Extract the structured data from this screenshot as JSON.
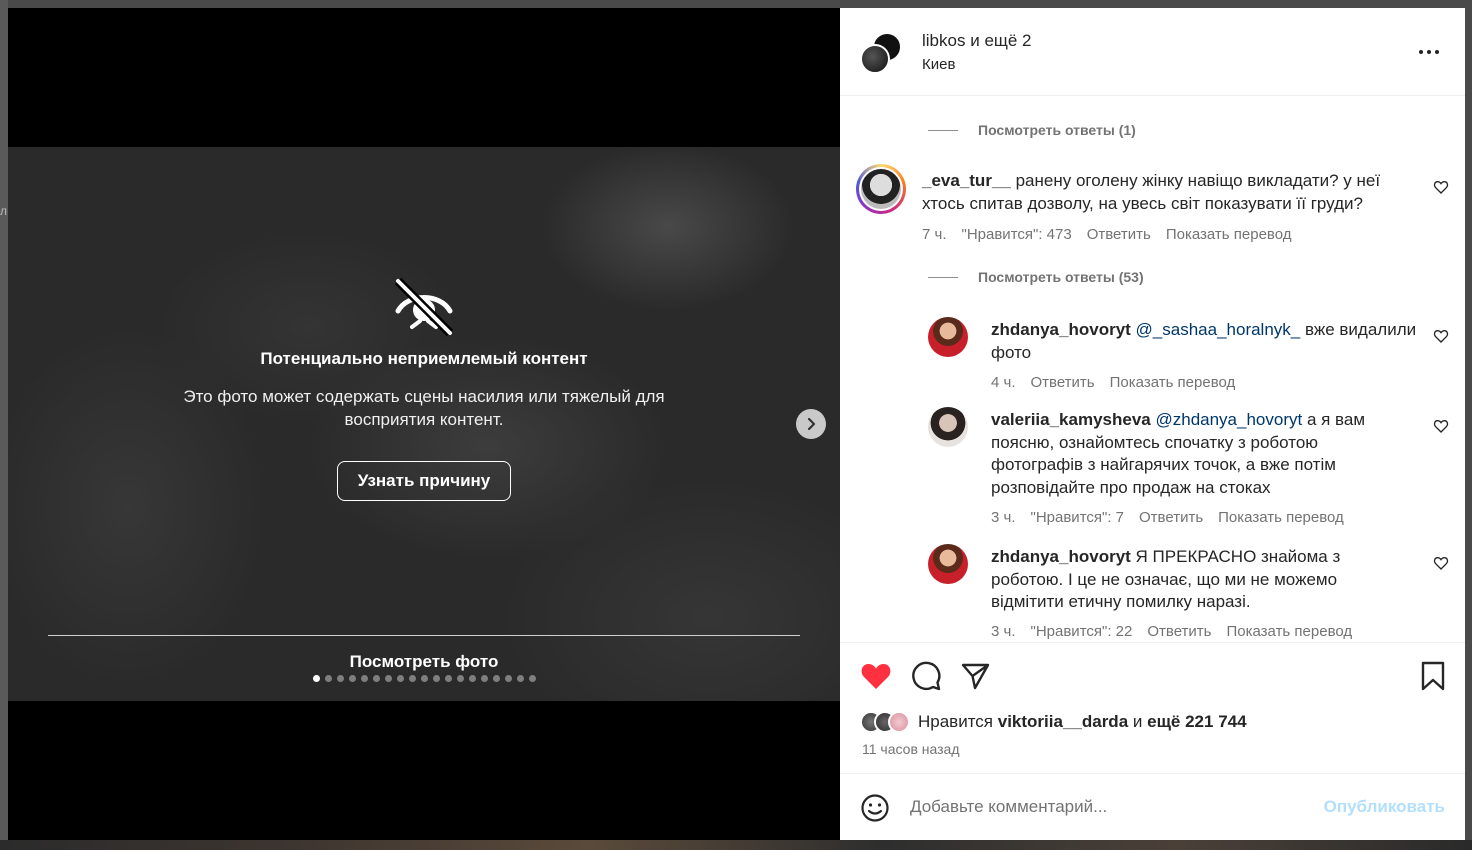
{
  "page": {
    "stray_char": "л"
  },
  "media": {
    "warning_title": "Потенциально неприемлемый контент",
    "warning_desc": "Это фото может содержать сцены насилия или тяжелый для восприятия контент.",
    "reason_button": "Узнать причину",
    "see_photo": "Посмотреть фото",
    "dots_total": 19,
    "dots_active": 0
  },
  "header": {
    "username": "libkos",
    "and_text": "и",
    "others": "ещё 2",
    "location": "Киев"
  },
  "comments": {
    "replies_1": "Посмотреть ответы (1)",
    "replies_53": "Посмотреть ответы (53)",
    "c1": {
      "user": "_eva_tur__",
      "text": "ранену оголену жінку навіщо викладати? у неї хтось спитав дозволу, на увесь світ показувати її груди?",
      "time": "7 ч.",
      "likes": "\"Нравится\": 473",
      "reply": "Ответить",
      "translate": "Показать перевод"
    },
    "c2": {
      "user": "zhdanya_hovoryt",
      "mention": "@_sashaa_horalnyk_",
      "text": "вже видалили фото",
      "time": "4 ч.",
      "reply": "Ответить",
      "translate": "Показать перевод"
    },
    "c3": {
      "user": "valeriia_kamysheva",
      "mention": "@zhdanya_hovoryt",
      "text": "а я вам поясню, ознайомтесь спочатку з роботою фотографів з найгарячих точок, а вже потім розповідайте про продаж на стоках",
      "time": "3 ч.",
      "likes": "\"Нравится\": 7",
      "reply": "Ответить",
      "translate": "Показать перевод"
    },
    "c4": {
      "user": "zhdanya_hovoryt",
      "text": "Я ПРЕКРАСНО знайома з роботою. І це не означає, що ми не можемо відмітити етичну помилку наразі.",
      "time": "3 ч.",
      "likes": "\"Нравится\": 22",
      "reply": "Ответить",
      "translate": "Показать перевод"
    }
  },
  "actions": {
    "likes_prefix": "Нравится",
    "liker": "viktoriia__darda",
    "likes_mid": "и",
    "likes_count": "ещё 221 744",
    "time_ago": "11 часов назад",
    "liked": true
  },
  "add_comment": {
    "placeholder": "Добавьте комментарий...",
    "post": "Опубликовать"
  },
  "colors": {
    "heart": "#ff3040",
    "mention": "#00376b",
    "post_disabled": "#b2dffc"
  },
  "icons": [
    "eye-off-icon",
    "chevron-right-icon",
    "more-icon",
    "heart-icon",
    "comment-icon",
    "share-icon",
    "bookmark-icon",
    "emoji-icon"
  ]
}
